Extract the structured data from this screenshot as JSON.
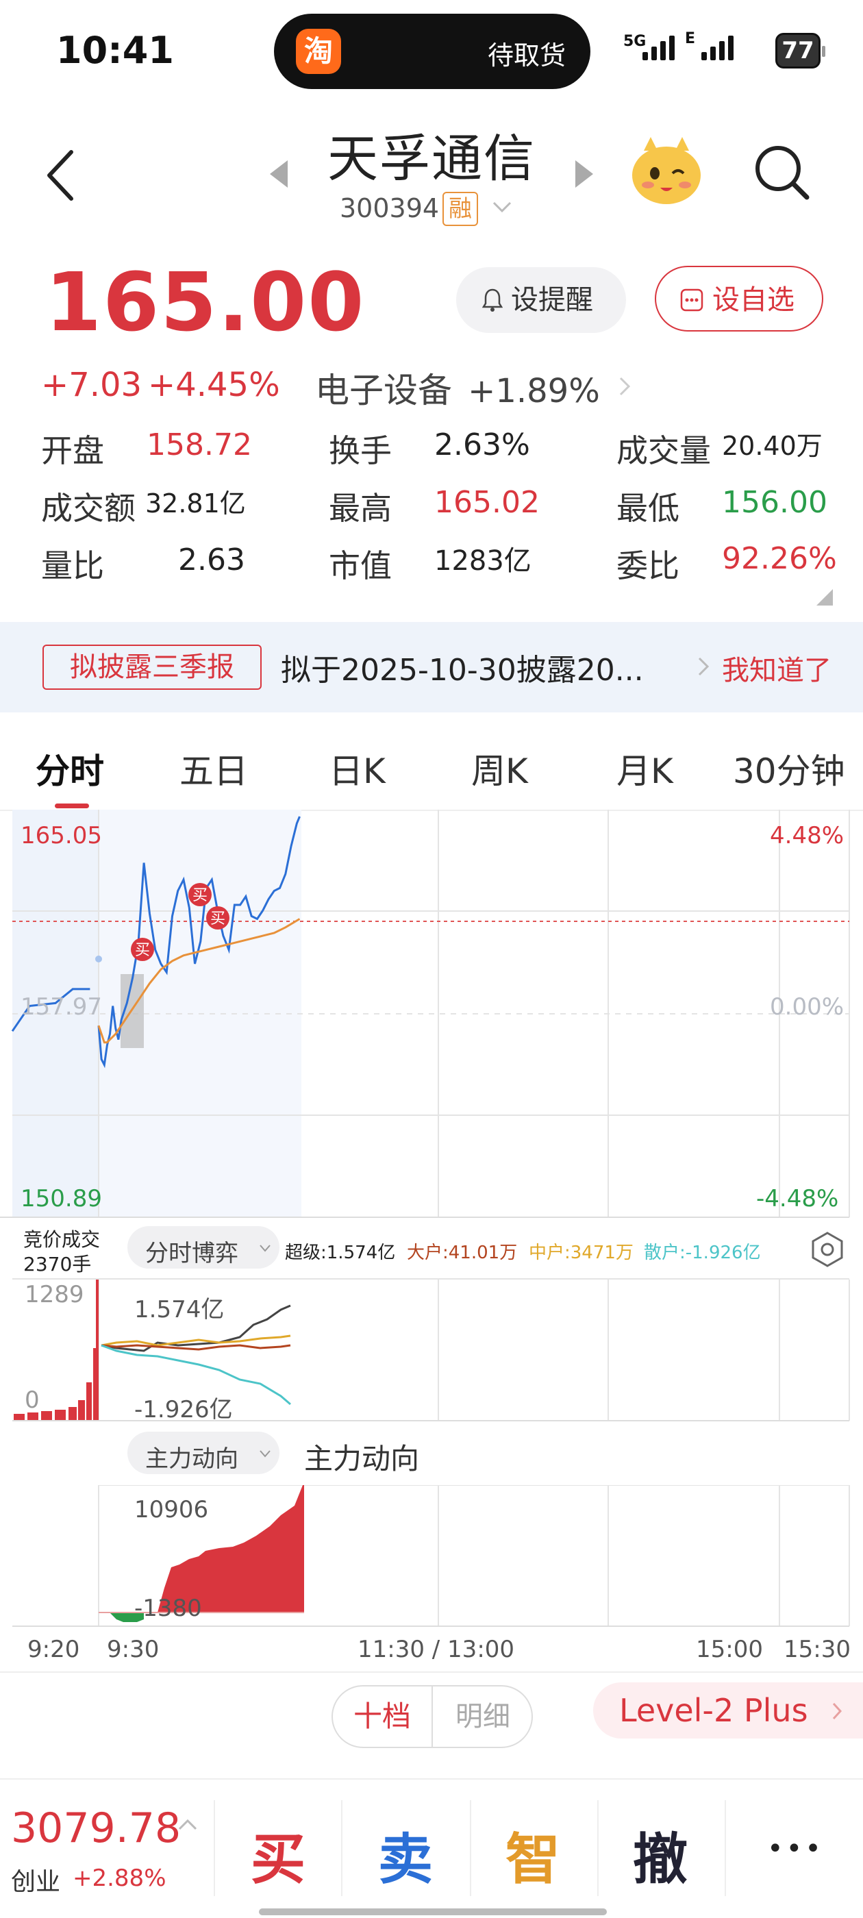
{
  "status_bar": {
    "time": "10:41",
    "app_name": "待取货",
    "app_icon_char": "淘",
    "net1": "5G",
    "net2": "E",
    "battery": "77"
  },
  "header": {
    "stock_name": "天孚通信",
    "stock_code": "300394",
    "margin_tag": "融",
    "icons": [
      "back-icon",
      "prev-stock-icon",
      "next-stock-icon",
      "mascot-icon",
      "search-icon"
    ]
  },
  "quote": {
    "price": "165.00",
    "change": "+7.03",
    "change_pct": "+4.45%",
    "sector_name": "电子设备",
    "sector_pct": "+1.89%",
    "alert_btn": "设提醒",
    "watch_btn": "设自选",
    "stats": [
      {
        "label": "开盘",
        "value": "158.72",
        "color": "#d9363e"
      },
      {
        "label": "换手",
        "value": "2.63%",
        "color": "#222222"
      },
      {
        "label": "成交量",
        "value": "20.40万",
        "color": "#222222"
      },
      {
        "label": "成交额",
        "value": "32.81亿",
        "color": "#222222"
      },
      {
        "label": "最高",
        "value": "165.02",
        "color": "#d9363e"
      },
      {
        "label": "最低",
        "value": "156.00",
        "color": "#2a9d4a"
      },
      {
        "label": "量比",
        "value": "2.63",
        "color": "#222222"
      },
      {
        "label": "市值",
        "value": "1283亿",
        "color": "#222222"
      },
      {
        "label": "委比",
        "value": "92.26%",
        "color": "#d9363e"
      }
    ]
  },
  "notice": {
    "tag": "拟披露三季报",
    "text": "拟于2025-10-30披露20...",
    "action": "我知道了"
  },
  "tabs": [
    "分时",
    "五日",
    "日K",
    "周K",
    "月K",
    "30分钟"
  ],
  "intraday": {
    "y_high": "165.05",
    "y_mid": "157.97",
    "y_low": "150.89",
    "pct_high": "4.48%",
    "pct_mid": "0.00%",
    "pct_low": "-4.48%",
    "buy_marker": "买"
  },
  "flow": {
    "auction_label": "竞价成交",
    "auction_vol": "2370手",
    "dropdown": "分时博弈",
    "super_label": "超级:1.574亿",
    "big_label": "大户:41.01万",
    "mid_label": "中户:3471万",
    "retail_label": "散户:-1.926亿",
    "left_top": "1289",
    "left_zero": "0",
    "max_label": "1.574亿",
    "min_label": "-1.926亿"
  },
  "mainforce": {
    "dropdown": "主力动向",
    "title": "主力动向",
    "max_label": "10906",
    "min_label": "-1380"
  },
  "time_axis": [
    "9:20",
    "9:30",
    "11:30 / 13:00",
    "15:00",
    "15:30"
  ],
  "orderbook": {
    "tab1": "十档",
    "tab2": "明细",
    "level2": "Level-2 Plus"
  },
  "bottom": {
    "index_value": "3079.78",
    "index_name": "创业",
    "index_pct": "+2.88%",
    "buy": "买",
    "sell": "卖",
    "smart": "智",
    "cancel": "撤",
    "more": "•••"
  },
  "chart_data": {
    "type": "line",
    "title": "",
    "xlabel": "",
    "ylabel": "",
    "ylim": [
      150.89,
      165.05
    ],
    "x_ticks": [
      "9:30",
      "11:30 / 13:00",
      "15:00"
    ],
    "series": [
      {
        "x": [
          "9:20",
          "9:22",
          "9:25",
          "9:27",
          "9:29"
        ],
        "values": [
          157.4,
          158.3,
          158.4,
          158.9,
          158.9
        ]
      },
      {
        "x": [
          "9:30",
          "9:31",
          "9:32",
          "9:33",
          "9:34",
          "9:35",
          "9:36",
          "9:37",
          "9:38",
          "9:40",
          "9:42",
          "9:44",
          "9:46",
          "9:48",
          "9:50",
          "9:52",
          "9:54",
          "9:56",
          "9:58",
          "10:00",
          "10:02",
          "10:04",
          "10:06",
          "10:08",
          "10:10",
          "10:12",
          "10:14",
          "10:16",
          "10:18",
          "10:20",
          "10:22",
          "10:24",
          "10:26",
          "10:28",
          "10:30",
          "10:32",
          "10:34",
          "10:36",
          "10:38",
          "10:40",
          "10:41"
        ],
        "values": [
          157.6,
          156.4,
          156.2,
          156.9,
          157.3,
          158.3,
          157.5,
          157.1,
          157.8,
          158.4,
          159.3,
          160.5,
          163.4,
          161.6,
          160.3,
          159.8,
          159.5,
          161.5,
          162.4,
          162.8,
          161.8,
          159.8,
          160.6,
          162.5,
          162.8,
          161.7,
          160.8,
          160.3,
          161.9,
          161.9,
          162.2,
          161.5,
          161.4,
          161.7,
          162.1,
          162.4,
          162.5,
          163.0,
          164.0,
          164.8,
          165.05
        ]
      },
      {
        "x": [
          "9:30",
          "9:31",
          "9:32",
          "9:33",
          "9:34",
          "9:36",
          "9:40",
          "9:44",
          "9:48",
          "9:52",
          "9:56",
          "10:00",
          "10:04",
          "10:08",
          "10:12",
          "10:16",
          "10:20",
          "10:24",
          "10:28",
          "10:32",
          "10:36",
          "10:41"
        ],
        "values": [
          157.6,
          157.3,
          157.0,
          157.0,
          157.1,
          157.3,
          157.9,
          158.5,
          159.1,
          159.6,
          159.9,
          160.1,
          160.2,
          160.3,
          160.4,
          160.5,
          160.6,
          160.7,
          160.8,
          160.9,
          161.1,
          161.4
        ]
      }
    ]
  }
}
